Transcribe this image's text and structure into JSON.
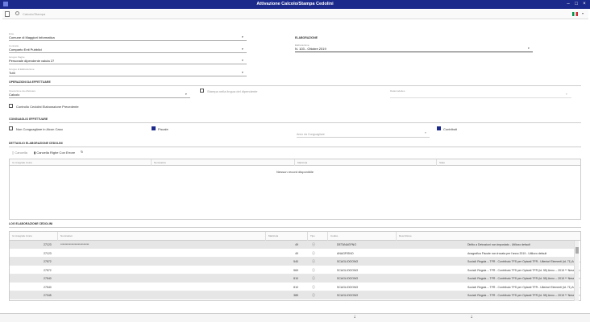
{
  "window": {
    "title": "Attivazione Calcolo/Stampa Cedolini"
  },
  "toolbar": {
    "search_placeholder": "Calcolo/Stampa"
  },
  "filters": {
    "ente": {
      "label": "Ente",
      "value": "Comune di Maggiori Informatica"
    },
    "contratto": {
      "label": "Contratto",
      "value": "Comparto Enti Pubblici"
    },
    "gruppo": {
      "label": "Gruppo Paghe",
      "value": "Personale dipendente valuta 27"
    },
    "gruppo_enti": {
      "label": "Gruppo di Elaborazione",
      "value": "Tutti"
    }
  },
  "elaborazione": {
    "section": "ELABORAZIONE",
    "label": "Elaborazione",
    "value": "N. 103 - Ottobre 2019"
  },
  "operazioni": {
    "section": "OPERAZIONI DA EFFETTUARE",
    "tipo_label": "Operazione da effettuare",
    "tipo_value": "Calcolo",
    "stampa_lingua": "Stampa nella lingua del dipendente",
    "datamodels": "Datamodelies",
    "controllo": "Controllo Cedolini Elaborazione Precedente"
  },
  "conguaglio": {
    "section": "CONGUAGLIO EFFETTUARE",
    "non_conguagliare": "Non Conguagliare in Alcun Caso",
    "fiscale": "Fiscale",
    "anno_placeholder": "Anno da Conguagliare",
    "contributi": "Contributi"
  },
  "dettaglio": {
    "section": "DETTAGLIO ELABORAZIONE CEDOLINI",
    "cancella": "Cancella",
    "cancella_errori": "Cancella Righe Con Errore",
    "headers": [
      "Id. Anagrafe Unica",
      "Nominativo",
      "Matricola",
      "Stato"
    ],
    "empty": "Nessun record disponibile"
  },
  "log": {
    "section": "LOG ELABORAZIONE CEDOLINI",
    "headers": [
      "Id. Anagrafe Unica",
      "Nominativo",
      "Matricola",
      "Tipo",
      "Codice",
      "Descrizione"
    ],
    "rows": [
      {
        "id": "27123",
        "nome": "**************************",
        "matr": "49",
        "codice": "DETANAGFNO",
        "desc": "Diritto a Detrazioni non impostato - Utilizzo default"
      },
      {
        "id": "27123",
        "nome": "",
        "matr": "49",
        "codice": "ANAGFISNO",
        "desc": "Anagrafica Fiscale non trovata per l'anno 2019 - Utilizzo default"
      },
      {
        "id": "27572",
        "nome": "",
        "matr": "540",
        "codice": "SCAGLIOOONO",
        "desc": "Sociali: Regola -- TFR - Contributo TFS per Optanti TFR - Ulteriori Elementi (id. 71) Anno -- 2019 ** Nessuno Scaglione Disponibile"
      },
      {
        "id": "27572",
        "nome": "",
        "matr": "569",
        "codice": "SCAGLIOOONO",
        "desc": "Sociali: Regola -- TFR - Contributo TFS per Optanti TFR (id. 55) Anno -- 2019 ** Nessuno Scaglione Disponibile"
      },
      {
        "id": "27540",
        "nome": "",
        "matr": "810",
        "codice": "SCAGLIOOONO",
        "desc": "Sociali: Regola -- TFR - Contributo TFS per Optanti TFR (id. 55) Anno -- 2019 ** Nessuno Scaglione Disponibile"
      },
      {
        "id": "27540",
        "nome": "",
        "matr": "810",
        "codice": "SCAGLIOOONO",
        "desc": "Sociali: Regola -- TFR - Contributo TFS per Optanti TFR - Ulteriori Elementi (id. 71) Anno -- 2019 ** Nessuno Scaglione Disponibile"
      },
      {
        "id": "27345",
        "nome": "",
        "matr": "385",
        "codice": "SCAGLIOOONO",
        "desc": "Sociali: Regola -- TFR - Contributo TFS per Optanti TFR (id. 55) Anno -- 2019 ** Nessuno Scaglione Disponibile"
      }
    ]
  }
}
